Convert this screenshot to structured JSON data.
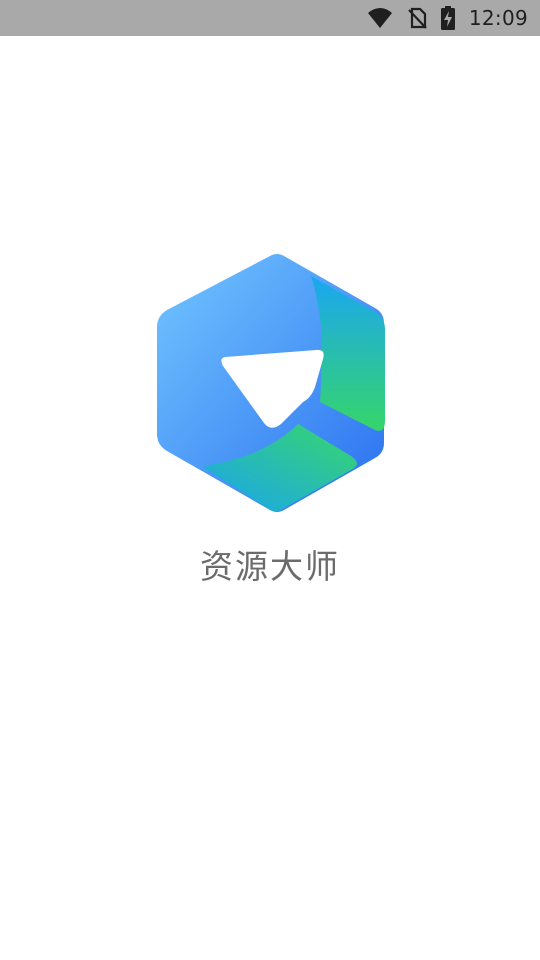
{
  "status_bar": {
    "time": "12:09",
    "icons": [
      "wifi-icon",
      "no-sim-icon",
      "battery-charging-icon"
    ]
  },
  "splash": {
    "app_name": "资源大师",
    "logo_icon": "app-logo-icon",
    "colors": {
      "blue_light": "#6cc3ff",
      "blue_dark": "#2f7bf0",
      "cyan": "#1fa9f0",
      "green": "#34d26a",
      "background": "#ffffff",
      "status_bar": "#a9a9a9",
      "title_text": "#6b6b6b"
    }
  }
}
